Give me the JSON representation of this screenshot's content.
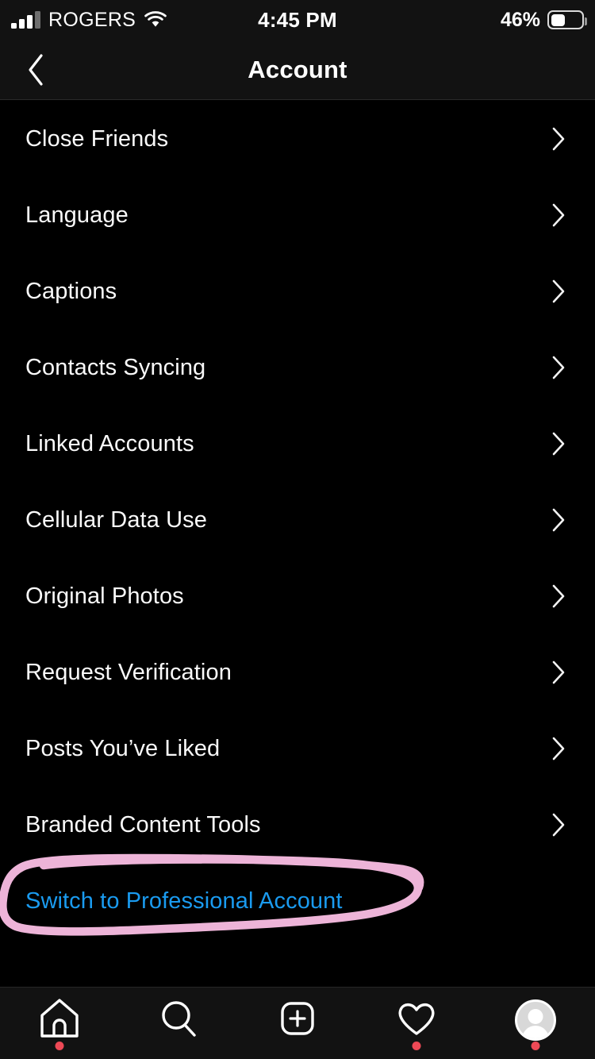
{
  "status_bar": {
    "carrier": "ROGERS",
    "time": "4:45 PM",
    "battery_percent": "46%",
    "battery_level": 46,
    "signal_bars_filled": 3,
    "signal_bars_total": 4,
    "wifi_icon": "wifi-icon",
    "battery_icon": "battery-icon"
  },
  "header": {
    "title": "Account",
    "back_icon": "chevron-left-icon"
  },
  "settings": {
    "rows": [
      {
        "label": "Close Friends",
        "chevron": "chevron-right-icon"
      },
      {
        "label": "Language",
        "chevron": "chevron-right-icon"
      },
      {
        "label": "Captions",
        "chevron": "chevron-right-icon"
      },
      {
        "label": "Contacts Syncing",
        "chevron": "chevron-right-icon"
      },
      {
        "label": "Linked Accounts",
        "chevron": "chevron-right-icon"
      },
      {
        "label": "Cellular Data Use",
        "chevron": "chevron-right-icon"
      },
      {
        "label": "Original Photos",
        "chevron": "chevron-right-icon"
      },
      {
        "label": "Request Verification",
        "chevron": "chevron-right-icon"
      },
      {
        "label": "Posts You’ve Liked",
        "chevron": "chevron-right-icon"
      },
      {
        "label": "Branded Content Tools",
        "chevron": "chevron-right-icon"
      }
    ],
    "switch_account": {
      "label": "Switch to Professional Account",
      "color": "#1a9bf0"
    }
  },
  "annotation": {
    "type": "hand-drawn-ellipse",
    "color": "#edb4d8",
    "target": "Switch to Professional Account"
  },
  "tab_bar": {
    "items": [
      {
        "name": "home-icon",
        "label": "Home",
        "has_badge": true
      },
      {
        "name": "search-icon",
        "label": "Search",
        "has_badge": false
      },
      {
        "name": "add-post-icon",
        "label": "New Post",
        "has_badge": false
      },
      {
        "name": "activity-heart-icon",
        "label": "Activity",
        "has_badge": true
      },
      {
        "name": "profile-avatar",
        "label": "Profile",
        "has_badge": true
      }
    ],
    "badge_color": "#ed4956"
  },
  "colors": {
    "background": "#000000",
    "chrome": "#121212",
    "text": "#fafafa",
    "link": "#1a9bf0",
    "annotation": "#edb4d8",
    "badge": "#ed4956"
  }
}
